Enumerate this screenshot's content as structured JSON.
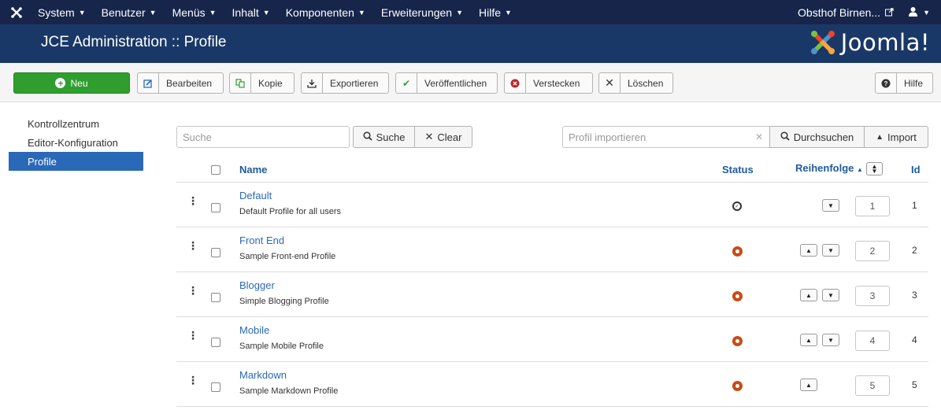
{
  "topnav": {
    "menu": [
      {
        "label": "System"
      },
      {
        "label": "Benutzer"
      },
      {
        "label": "Menüs"
      },
      {
        "label": "Inhalt"
      },
      {
        "label": "Komponenten"
      },
      {
        "label": "Erweiterungen"
      },
      {
        "label": "Hilfe"
      }
    ],
    "site_name": "Obsthof Birnen..."
  },
  "header": {
    "title": "JCE Administration :: Profile",
    "brand": "Joomla!"
  },
  "toolbar": {
    "new_label": "Neu",
    "edit_label": "Bearbeiten",
    "copy_label": "Kopie",
    "export_label": "Exportieren",
    "publish_label": "Veröffentlichen",
    "unpublish_label": "Verstecken",
    "delete_label": "Löschen",
    "help_label": "Hilfe"
  },
  "sidebar": {
    "items": [
      {
        "label": "Kontrollzentrum",
        "active": false
      },
      {
        "label": "Editor-Konfiguration",
        "active": false
      },
      {
        "label": "Profile",
        "active": true
      }
    ]
  },
  "filters": {
    "search_placeholder": "Suche",
    "search_button": "Suche",
    "clear_button": "Clear",
    "import_placeholder": "Profil importieren",
    "browse_button": "Durchsuchen",
    "import_button": "Import"
  },
  "table": {
    "headers": {
      "name": "Name",
      "status": "Status",
      "ordering": "Reihenfolge",
      "id": "Id"
    },
    "rows": [
      {
        "name": "Default",
        "description": "Default Profile for all users",
        "status": "published",
        "order": "1",
        "id": "1"
      },
      {
        "name": "Front End",
        "description": "Sample Front-end Profile",
        "status": "unpublished",
        "order": "2",
        "id": "2"
      },
      {
        "name": "Blogger",
        "description": "Simple Blogging Profile",
        "status": "unpublished",
        "order": "3",
        "id": "3"
      },
      {
        "name": "Mobile",
        "description": "Sample Mobile Profile",
        "status": "unpublished",
        "order": "4",
        "id": "4"
      },
      {
        "name": "Markdown",
        "description": "Sample Markdown Profile",
        "status": "unpublished",
        "order": "5",
        "id": "5"
      }
    ]
  },
  "colors": {
    "navbar": "#17254a",
    "header": "#1a3867",
    "accent": "#2a69b8",
    "new_button": "#2f9e2f",
    "status_unpublished": "#c84b14"
  }
}
